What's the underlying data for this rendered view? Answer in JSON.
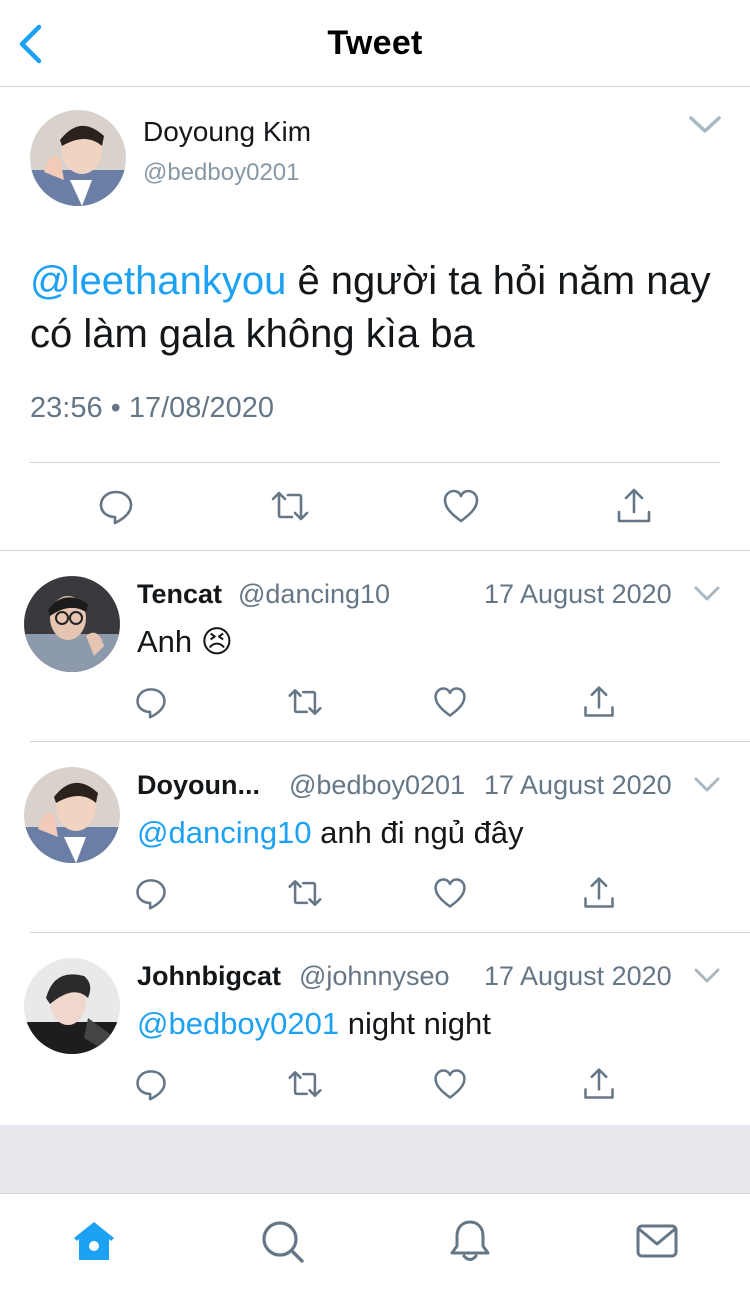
{
  "header": {
    "title": "Tweet",
    "back_icon": "chevron-left-icon"
  },
  "main_tweet": {
    "author_name": "Doyoung Kim",
    "author_handle": "@bedboy0201",
    "text_mention": "@leethankyou",
    "text_body": " ê người ta hỏi năm nay có làm gala không kìa ba",
    "timestamp": "23:56 • 17/08/2020",
    "actions": [
      "reply-icon",
      "retweet-icon",
      "like-icon",
      "share-icon"
    ]
  },
  "replies": [
    {
      "name": "Tencat",
      "handle": "@dancing10",
      "date": "17 August 2020",
      "mention": "",
      "text": "Anh ",
      "emoji": "😣"
    },
    {
      "name": "Doyoun...",
      "handle": "@bedboy0201",
      "date": "17 August 2020",
      "mention": "@dancing10",
      "text": " anh đi ngủ đây",
      "emoji": ""
    },
    {
      "name": "Johnbigcat",
      "handle": "@johnnyseo",
      "date": "17 August 2020",
      "mention": "@bedboy0201",
      "text": " night night",
      "emoji": ""
    }
  ],
  "tabbar": {
    "tabs": [
      "home-icon",
      "search-icon",
      "notifications-icon",
      "messages-icon"
    ],
    "active": "home-icon"
  },
  "colors": {
    "accent": "#1da1f2",
    "secondary_text": "#657786",
    "divider": "#cfd4d8",
    "icon_gray": "#657786"
  }
}
